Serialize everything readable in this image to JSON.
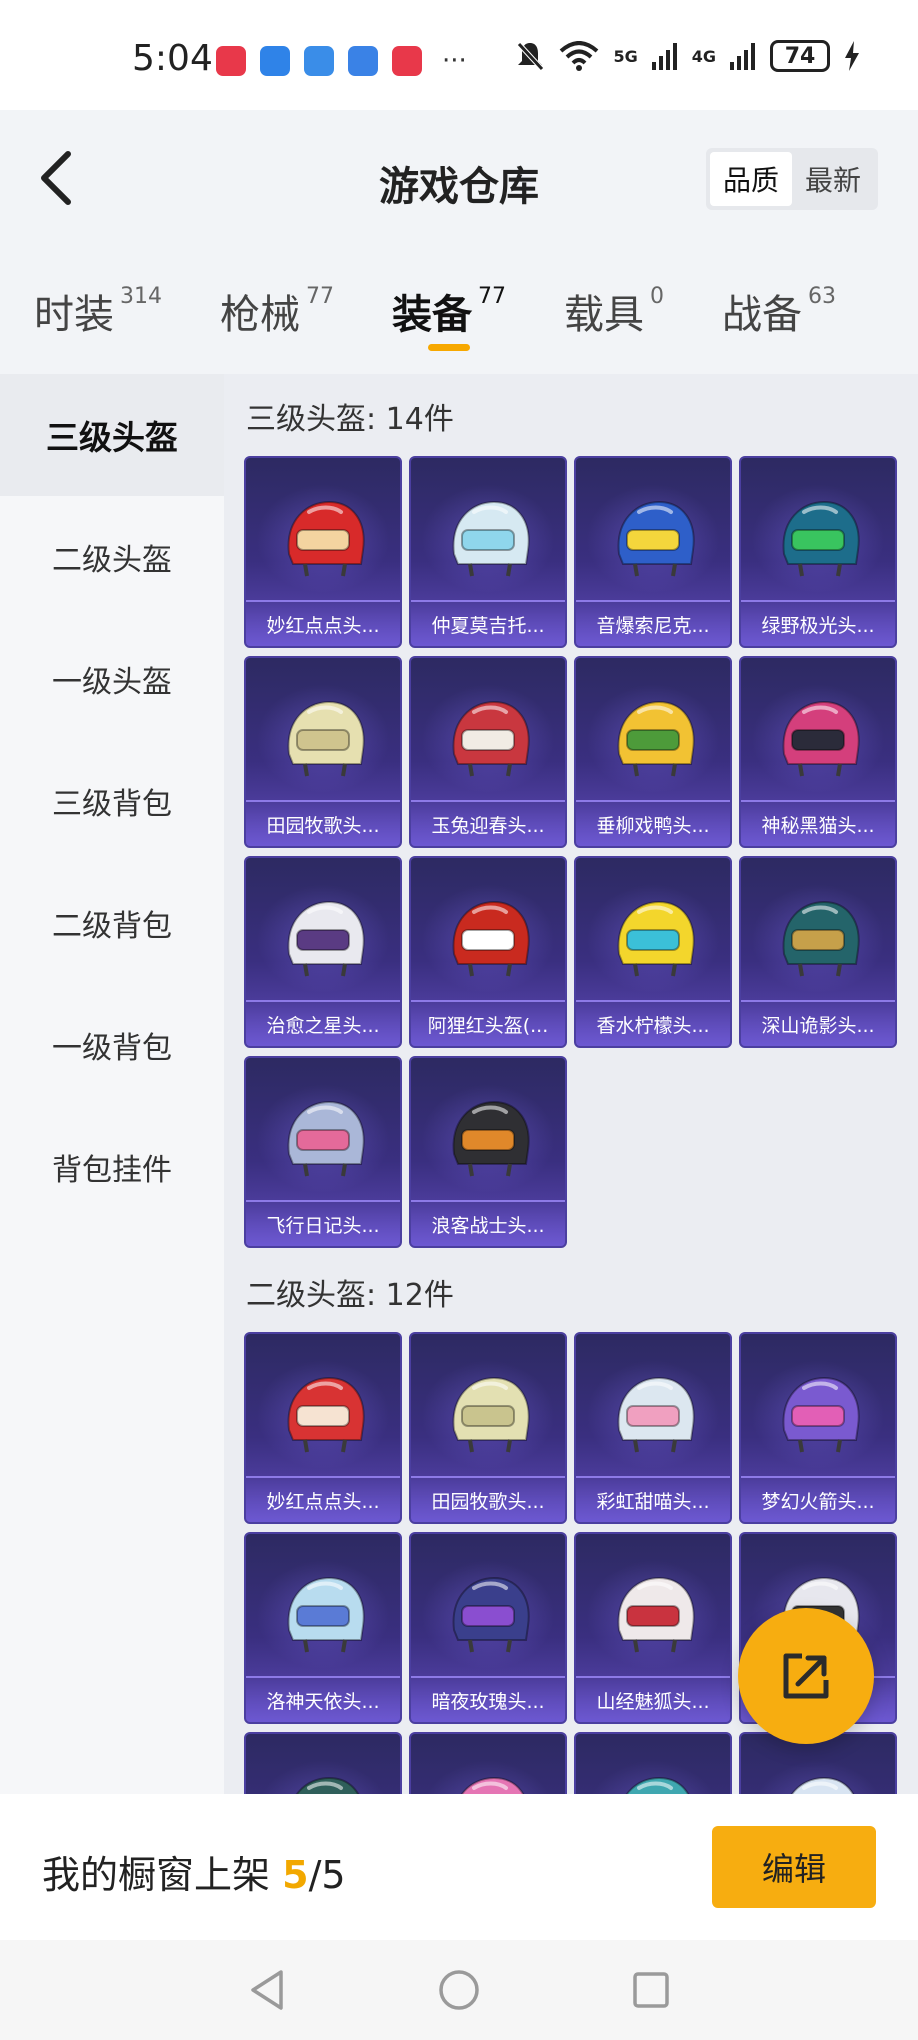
{
  "status": {
    "time": "5:04",
    "network_5g": "5G",
    "network_4g": "4G",
    "battery": "74"
  },
  "header": {
    "title": "游戏仓库",
    "sort_options": [
      "品质",
      "最新"
    ]
  },
  "tabs": [
    {
      "label": "时装",
      "count": "314"
    },
    {
      "label": "枪械",
      "count": "77"
    },
    {
      "label": "装备",
      "count": "77"
    },
    {
      "label": "载具",
      "count": "0"
    },
    {
      "label": "战备",
      "count": "63"
    }
  ],
  "sidebar": [
    "三级头盔",
    "二级头盔",
    "一级头盔",
    "三级背包",
    "二级背包",
    "一级背包",
    "背包挂件"
  ],
  "sections": [
    {
      "title": "三级头盔: 14件",
      "items": [
        {
          "name": "妙红点点头...",
          "color": "#d82a2a",
          "accent": "#f3d4a0"
        },
        {
          "name": "仲夏莫吉托...",
          "color": "#d6e9f2",
          "accent": "#8fd6ec"
        },
        {
          "name": "音爆索尼克...",
          "color": "#2e5fc9",
          "accent": "#f4d63c"
        },
        {
          "name": "绿野极光头...",
          "color": "#1d6d8b",
          "accent": "#39c45f"
        },
        {
          "name": "田园牧歌头...",
          "color": "#e6e0b0",
          "accent": "#cfc48e"
        },
        {
          "name": "玉兔迎春头...",
          "color": "#c9373f",
          "accent": "#f1ece4"
        },
        {
          "name": "垂柳戏鸭头...",
          "color": "#f2c233",
          "accent": "#4d9b3a"
        },
        {
          "name": "神秘黑猫头...",
          "color": "#d43f7c",
          "accent": "#2b2b3a"
        },
        {
          "name": "治愈之星头...",
          "color": "#e9e9ef",
          "accent": "#5a3b83"
        },
        {
          "name": "阿狸红头盔(...",
          "color": "#c92a1f",
          "accent": "#ffffff"
        },
        {
          "name": "香水柠檬头...",
          "color": "#f3d62c",
          "accent": "#3bc0d8"
        },
        {
          "name": "深山诡影头...",
          "color": "#24646a",
          "accent": "#c6a04a"
        },
        {
          "name": "飞行日记头...",
          "color": "#aab7d8",
          "accent": "#e46a9a"
        },
        {
          "name": "浪客战士头...",
          "color": "#2f2f33",
          "accent": "#e0882a"
        }
      ]
    },
    {
      "title": "二级头盔: 12件",
      "items": [
        {
          "name": "妙红点点头...",
          "color": "#d83333",
          "accent": "#f6e3d2"
        },
        {
          "name": "田园牧歌头...",
          "color": "#e3e0b2",
          "accent": "#c9c48e"
        },
        {
          "name": "彩虹甜喵头...",
          "color": "#dce7f0",
          "accent": "#f0a0c0"
        },
        {
          "name": "梦幻火箭头...",
          "color": "#7a5ad0",
          "accent": "#e25fb6"
        },
        {
          "name": "洛神天依头...",
          "color": "#b8dcef",
          "accent": "#5a7bd6"
        },
        {
          "name": "暗夜玫瑰头...",
          "color": "#3a3f8c",
          "accent": "#8a4ed0"
        },
        {
          "name": "山经魅狐头...",
          "color": "#efe9ea",
          "accent": "#c9333f"
        },
        {
          "name": "",
          "color": "#e7e7ee",
          "accent": "#333333"
        },
        {
          "name": "",
          "color": "#2f5f5a",
          "accent": "#e6b34a"
        },
        {
          "name": "",
          "color": "#e575b4",
          "accent": "#f4c0dd"
        },
        {
          "name": "",
          "color": "#3fa7b0",
          "accent": "#e0c84a"
        },
        {
          "name": "",
          "color": "#d8e4f2",
          "accent": "#c4d0e8"
        }
      ]
    }
  ],
  "bottom": {
    "showcase_label": "我的橱窗上架",
    "current": "5",
    "separator": "/",
    "total": "5",
    "edit": "编辑"
  }
}
